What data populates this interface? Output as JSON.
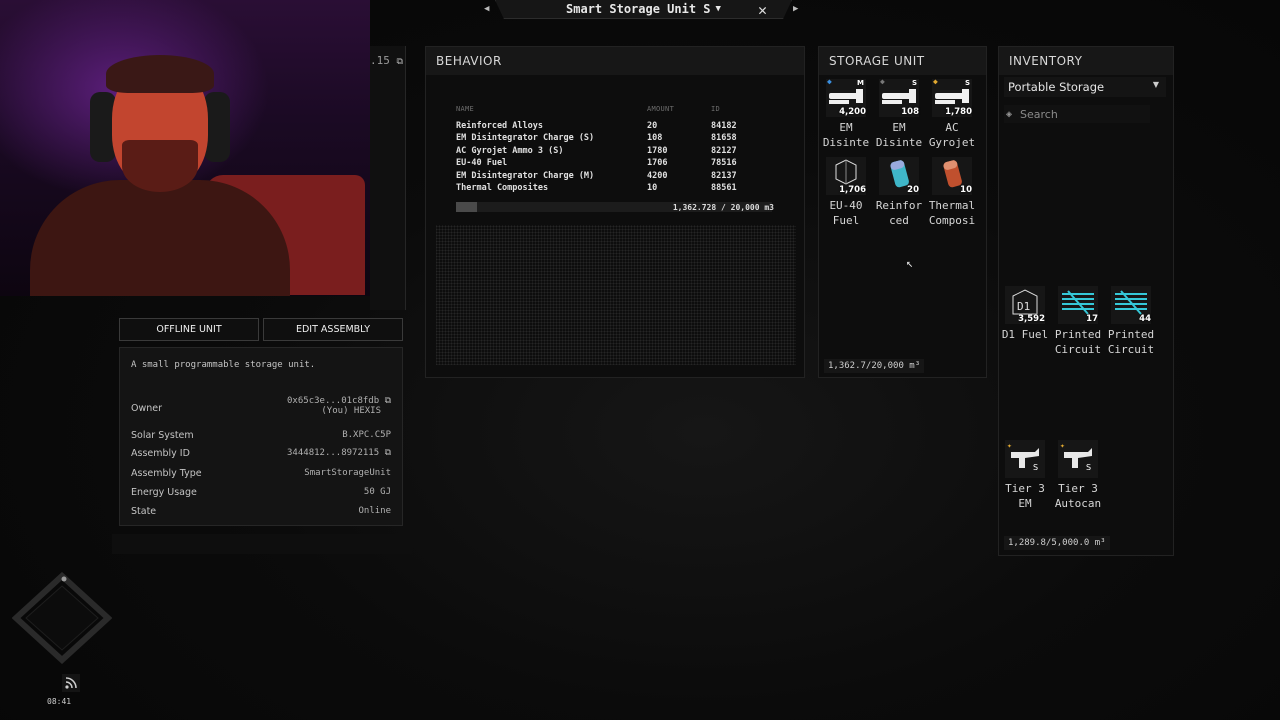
{
  "window": {
    "title": "Smart Storage Unit S",
    "dropdown_icon": "chevron-down-icon",
    "close_icon": "close-icon",
    "prev_icon": "triangle-left-icon",
    "next_icon": "triangle-right-icon"
  },
  "left_stub": {
    "text": ".15"
  },
  "actions": {
    "offline": "OFFLINE UNIT",
    "edit": "EDIT ASSEMBLY"
  },
  "info": {
    "description": "A small programmable storage unit.",
    "rows": [
      {
        "label": "Owner",
        "value": "0x65c3e...01c8fdb",
        "value2": "(You) HEXIS",
        "copy": true
      },
      {
        "label": "Solar System",
        "value": "B.XPC.C5P"
      },
      {
        "label": "Assembly ID",
        "value": "3444812...8972115",
        "copy": true
      },
      {
        "label": "Assembly Type",
        "value": "SmartStorageUnit"
      },
      {
        "label": "Energy Usage",
        "value": "50 GJ"
      },
      {
        "label": "State",
        "value": "Online"
      }
    ]
  },
  "behavior": {
    "title": "BEHAVIOR",
    "columns": [
      "NAME",
      "AMOUNT",
      "ID"
    ],
    "rows": [
      [
        "Reinforced Alloys",
        "20",
        "84182"
      ],
      [
        "EM Disintegrator Charge (S)",
        "108",
        "81658"
      ],
      [
        "AC Gyrojet Ammo 3 (S)",
        "1780",
        "82127"
      ],
      [
        "EU-40 Fuel",
        "1706",
        "78516"
      ],
      [
        "EM Disintegrator Charge (M)",
        "4200",
        "82137"
      ],
      [
        "Thermal Composites",
        "10",
        "88561"
      ]
    ],
    "capacity_text": "1,362.728 / 20,000 m3",
    "fill_fraction": 0.068
  },
  "storage": {
    "title": "STORAGE UNIT",
    "items": [
      {
        "name": "EM\nDisinte",
        "count": "4,200",
        "size": "M",
        "dot": "#3a8fe0",
        "icon": "em-charge-icon"
      },
      {
        "name": "EM\nDisinte",
        "count": "108",
        "size": "S",
        "dot": "#777777",
        "icon": "em-charge-icon"
      },
      {
        "name": "AC\nGyrojet",
        "count": "1,780",
        "size": "S",
        "dot": "#e0a830",
        "icon": "gyrojet-ammo-icon"
      },
      {
        "name": "EU-40\nFuel",
        "count": "1,706",
        "icon": "fuel-icon"
      },
      {
        "name": "Reinfor\nced",
        "count": "20",
        "icon": "reinforced-alloy-icon"
      },
      {
        "name": "Thermal\nComposi",
        "count": "10",
        "icon": "thermal-composite-icon"
      }
    ],
    "capacity": "1,362.7/20,000 m³"
  },
  "inventory": {
    "title": "INVENTORY",
    "selected": "Portable Storage",
    "search_placeholder": "Search",
    "filter_icon": "layers-icon",
    "items": [
      {
        "name": "D1 Fuel",
        "count": "3,592",
        "icon": "d1-fuel-icon"
      },
      {
        "name": "Printed\nCircuit",
        "count": "17",
        "icon": "printed-circuit-icon"
      },
      {
        "name": "Printed\nCircuit",
        "count": "44",
        "icon": "printed-circuit-icon"
      }
    ],
    "modules": [
      {
        "name": "Tier 3\nEM",
        "count": "",
        "icon": "tier3-em-icon"
      },
      {
        "name": "Tier 3\nAutocan",
        "count": "",
        "icon": "tier3-autocannon-icon"
      }
    ],
    "capacity": "1,289.8/5,000.0 m³"
  },
  "hud": {
    "clock": "08:41",
    "signal_icon": "rss-icon",
    "compass_icon": "compass-icon"
  }
}
